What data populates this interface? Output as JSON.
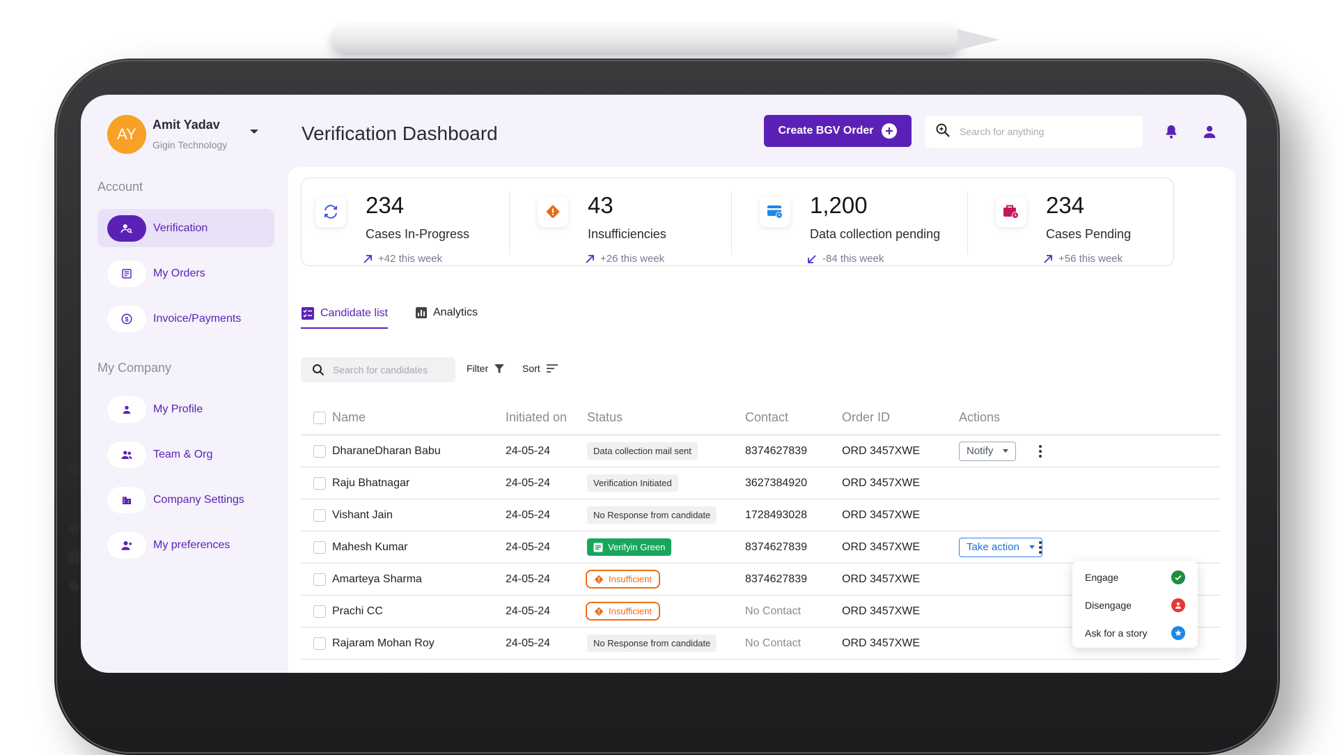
{
  "user": {
    "initials": "AY",
    "name": "Amit Yadav",
    "org": "Gigin Technology"
  },
  "sidebar": {
    "account_label": "Account",
    "account_items": [
      {
        "label": "Verification",
        "icon": "user-search-icon",
        "active": true
      },
      {
        "label": "My Orders",
        "icon": "orders-icon",
        "active": false
      },
      {
        "label": "Invoice/Payments",
        "icon": "dollar-icon",
        "active": false
      }
    ],
    "company_label": "My Company",
    "company_items": [
      {
        "label": "My Profile",
        "icon": "person-icon"
      },
      {
        "label": "Team & Org",
        "icon": "team-icon"
      },
      {
        "label": "Company Settings",
        "icon": "building-icon"
      },
      {
        "label": "My preferences",
        "icon": "person-add-icon"
      }
    ]
  },
  "header": {
    "title": "Verification Dashboard",
    "create_label": "Create BGV Order",
    "search_placeholder": "Search for anything"
  },
  "stats": [
    {
      "value": "234",
      "label": "Cases In-Progress",
      "trend": "+42 this week",
      "icon": "refresh-icon"
    },
    {
      "value": "43",
      "label": "Insufficiencies",
      "trend": "+26 this week",
      "icon": "warning-diamond-icon"
    },
    {
      "value": "1,200",
      "label": "Data collection pending",
      "trend": "-84 this week",
      "icon": "card-clock-icon"
    },
    {
      "value": "234",
      "label": "Cases Pending",
      "trend": "+56 this week",
      "icon": "briefcase-clock-icon"
    }
  ],
  "tabs": [
    {
      "label": "Candidate list",
      "active": true
    },
    {
      "label": "Analytics",
      "active": false
    }
  ],
  "toolbar": {
    "search_placeholder": "Search for candidates",
    "filter_label": "Filter",
    "sort_label": "Sort"
  },
  "table": {
    "columns": [
      "Name",
      "Initiated on",
      "Status",
      "Contact",
      "Order ID",
      "Actions"
    ],
    "rows": [
      {
        "name": "DharaneDharan Babu",
        "date": "24-05-24",
        "status": "Data collection mail sent",
        "status_type": "grey",
        "contact": "8374627839",
        "order": "ORD 3457XWE",
        "action": "Notify"
      },
      {
        "name": "Raju Bhatnagar",
        "date": "24-05-24",
        "status": "Verification Initiated",
        "status_type": "grey",
        "contact": "3627384920",
        "order": "ORD 3457XWE",
        "action": ""
      },
      {
        "name": "Vishant Jain",
        "date": "24-05-24",
        "status": "No Response from candidate",
        "status_type": "grey",
        "contact": "1728493028",
        "order": "ORD 3457XWE",
        "action": ""
      },
      {
        "name": "Mahesh Kumar",
        "date": "24-05-24",
        "status": "Verifyin Green",
        "status_type": "green",
        "contact": "8374627839",
        "order": "ORD 3457XWE",
        "action": "Take action"
      },
      {
        "name": "Amarteya Sharma",
        "date": "24-05-24",
        "status": "Insufficient",
        "status_type": "orange",
        "contact": "8374627839",
        "order": "ORD 3457XWE",
        "action": ""
      },
      {
        "name": "Prachi CC",
        "date": "24-05-24",
        "status": "Insufficient",
        "status_type": "orange",
        "contact": "No Contact",
        "order": "ORD 3457XWE",
        "action": ""
      },
      {
        "name": "Rajaram Mohan Roy",
        "date": "24-05-24",
        "status": "No Response from candidate",
        "status_type": "grey",
        "contact": "No Contact",
        "order": "ORD 3457XWE",
        "action": ""
      }
    ]
  },
  "action_menu": [
    {
      "label": "Engage",
      "icon": "check-circle-icon",
      "color": "#1e8e3e"
    },
    {
      "label": "Disengage",
      "icon": "person-off-icon",
      "color": "#e53935"
    },
    {
      "label": "Ask for a story",
      "icon": "star-circle-icon",
      "color": "#1e88e5"
    }
  ],
  "colors": {
    "primary": "#5b21b6",
    "avatar": "#f7a126",
    "screen_bg": "#f5f2fb",
    "insufficient": "#ee6c17",
    "green": "#18a65b"
  }
}
